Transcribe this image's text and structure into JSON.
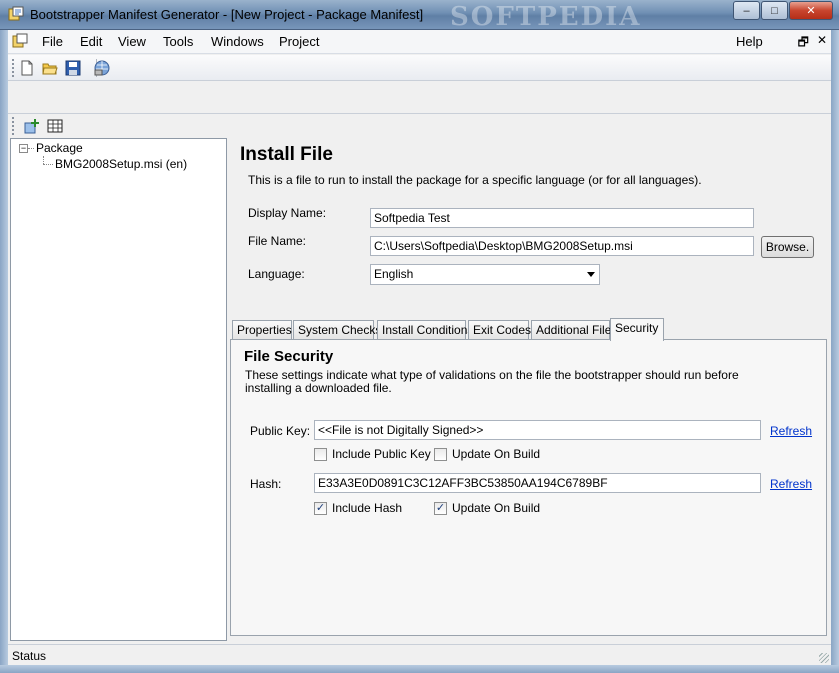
{
  "window": {
    "title": "Bootstrapper Manifest Generator - [New Project - Package Manifest]",
    "watermark": "SOFTPEDIA",
    "minimize": "–",
    "maximize": "□",
    "close": "✕"
  },
  "menu": {
    "items": [
      "File",
      "Edit",
      "View",
      "Tools",
      "Windows",
      "Project"
    ],
    "help": "Help",
    "mdi_restore": "🗗",
    "mdi_close": "✕"
  },
  "tree": {
    "root": "Package",
    "expander": "−",
    "child": "BMG2008Setup.msi  (en)"
  },
  "install_file": {
    "title": "Install File",
    "description": "This is a file to run to install the package for a specific language (or for all languages).",
    "display_name_label": "Display Name:",
    "display_name_value": "Softpedia Test",
    "file_name_label": "File Name:",
    "file_name_value": "C:\\Users\\Softpedia\\Desktop\\BMG2008Setup.msi",
    "browse_label": "Browse.",
    "language_label": "Language:",
    "language_value": "English"
  },
  "tabs": [
    "Properties",
    "System Checks",
    "Install Conditions",
    "Exit Codes",
    "Additional Files",
    "Security"
  ],
  "security": {
    "title": "File Security",
    "description": "These settings indicate what type of validations on the file the bootstrapper should run before installing a downloaded file.",
    "public_key_label": "Public Key:",
    "public_key_value": "<<File is not Digitally Signed>>",
    "refresh_label": "Refresh",
    "include_public_key_label": "Include Public Key",
    "include_public_key_checked": false,
    "update_on_build_label": "Update On Build",
    "update_public_key_checked": false,
    "hash_label": "Hash:",
    "hash_value": "E33A3E0D0891C3C12AFF3BC53850AA194C6789BF",
    "include_hash_label": "Include Hash",
    "include_hash_checked": true,
    "update_hash_checked": true,
    "check_mark": "✓"
  },
  "status": {
    "text": "Status"
  }
}
